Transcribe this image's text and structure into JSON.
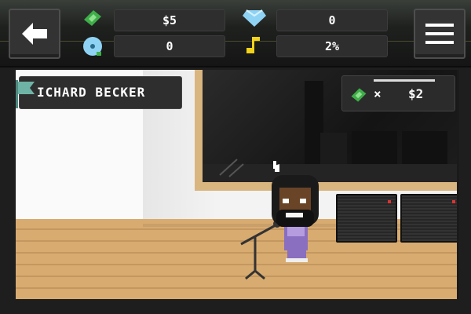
{
  "hud": {
    "money": "$5",
    "gems": "0",
    "records": "0",
    "hype": "2%"
  },
  "name_tag": {
    "text": "ICHARD BECKER"
  },
  "money_tag": {
    "multiplier": "×",
    "value": "$2",
    "progress": 0.6
  },
  "icons": {
    "back": "back-arrow-icon",
    "menu": "hamburger-menu-icon",
    "money": "cash-icon",
    "gems": "diamond-icon",
    "records": "record-disc-icon",
    "hype": "music-note-icon",
    "flag": "flag-icon"
  },
  "colors": {
    "cash": "#3fae49",
    "diamond": "#8fd3f4",
    "note": "#f2d21b",
    "flag": "#6fb3a6"
  }
}
